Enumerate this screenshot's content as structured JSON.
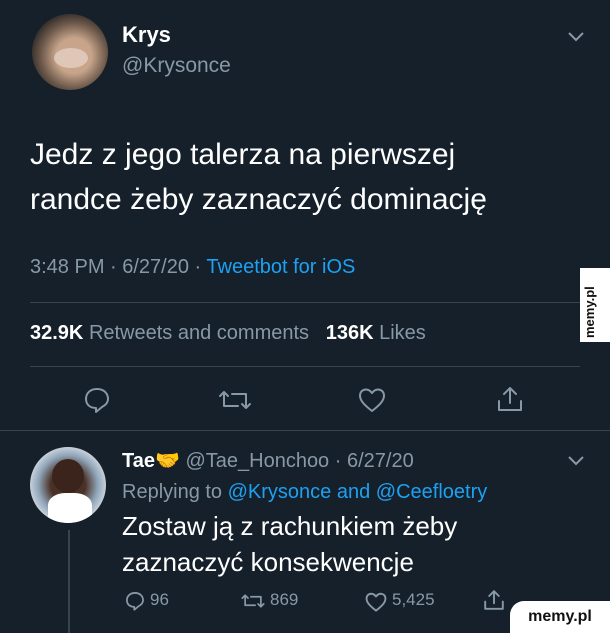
{
  "tweet": {
    "author_name": "Krys",
    "author_handle": "@Krysonce",
    "text_line1": "Jedz z jego talerza na pierwszej",
    "text_line2": "randce żeby zaznaczyć dominację",
    "time_date": "3:48 PM · 6/27/20 ·",
    "source": "Tweetbot for iOS",
    "retweets_count": "32.9K",
    "retweets_label": "Retweets and comments",
    "likes_count": "136K",
    "likes_label": "Likes"
  },
  "reply": {
    "author_name": "Tae",
    "emoji": "🤝",
    "meta": "@Tae_Honchoo · 6/27/20",
    "replying_prefix": "Replying to",
    "replying_to": "@Krysonce and @Ceefloetry",
    "text_line1": "Zostaw ją z rachunkiem żeby",
    "text_line2": "zaznaczyć konsekwencje",
    "comments": "96",
    "retweets": "869",
    "likes": "5,425"
  },
  "watermark": {
    "side": "memy.pl",
    "corner": "memy.pl"
  },
  "colors": {
    "background": "#15202b",
    "link": "#1da1f2",
    "muted": "#8899a6"
  }
}
